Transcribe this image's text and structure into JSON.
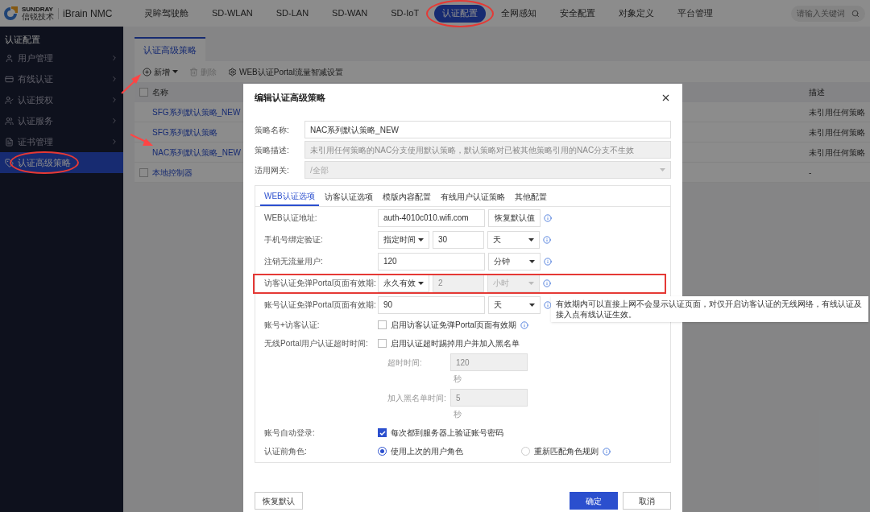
{
  "header": {
    "brand": "SUNDRAY",
    "brand_cn": "信锐技术",
    "product": "iBrain NMC",
    "nav": [
      {
        "label": "灵眸驾驶舱",
        "selected": false,
        "circled": false
      },
      {
        "label": "SD-WLAN",
        "selected": false,
        "circled": false
      },
      {
        "label": "SD-LAN",
        "selected": false,
        "circled": false
      },
      {
        "label": "SD-WAN",
        "selected": false,
        "circled": false
      },
      {
        "label": "SD-IoT",
        "selected": false,
        "circled": false
      },
      {
        "label": "认证配置",
        "selected": true,
        "circled": true
      },
      {
        "label": "全网感知",
        "selected": false,
        "circled": false
      },
      {
        "label": "安全配置",
        "selected": false,
        "circled": false
      },
      {
        "label": "对象定义",
        "selected": false,
        "circled": false
      },
      {
        "label": "平台管理",
        "selected": false,
        "circled": false
      }
    ],
    "search": {
      "placeholder": "请输入关键词"
    }
  },
  "sidebar": {
    "title": "认证配置",
    "items": [
      {
        "label": "用户管理",
        "selected": false,
        "circled": false
      },
      {
        "label": "有线认证",
        "selected": false,
        "circled": false
      },
      {
        "label": "认证授权",
        "selected": false,
        "circled": false
      },
      {
        "label": "认证服务",
        "selected": false,
        "circled": false
      },
      {
        "label": "证书管理",
        "selected": false,
        "circled": false
      },
      {
        "label": "认证高级策略",
        "selected": true,
        "circled": true
      }
    ]
  },
  "main": {
    "tab": "认证高级策略",
    "toolbar": [
      {
        "kind": "add",
        "label": "新增",
        "disabled": false,
        "annotated": true
      },
      {
        "kind": "delete",
        "label": "删除",
        "disabled": true
      },
      {
        "kind": "settings",
        "label": "WEB认证Portal流量智减设置",
        "disabled": false
      }
    ],
    "table": {
      "select_all_checked": false,
      "columns": [
        "名称",
        "描述"
      ],
      "rows": [
        {
          "name": "SFG系列默认策略_NEW",
          "description": "未引用任何策略",
          "checkbox": false,
          "annotated": false
        },
        {
          "name": "SFG系列默认策略",
          "description": "未引用任何策略",
          "checkbox": false,
          "annotated": false
        },
        {
          "name": "NAC系列默认策略_NEW",
          "description": "未引用任何策略",
          "checkbox": false,
          "annotated": true
        },
        {
          "name": "本地控制器",
          "description": "-",
          "checkbox": true,
          "checked": false,
          "annotated": false
        }
      ]
    }
  },
  "dialog": {
    "title": "编辑认证高级策略",
    "fields": [
      {
        "kind": "input",
        "label": "策略名称:",
        "value": "NAC系列默认策略_NEW",
        "disabled": false
      },
      {
        "kind": "input",
        "label": "策略描述:",
        "value": "未引用任何策略的NAC分支使用默认策略，默认策略对已被其他策略引用的NAC分支不生效",
        "disabled": true
      },
      {
        "kind": "select",
        "label": "适用网关:",
        "value": "/全部",
        "disabled": true
      }
    ],
    "tabs": [
      {
        "label": "WEB认证选项",
        "selected": true
      },
      {
        "label": "访客认证选项",
        "selected": false
      },
      {
        "label": "模版内容配置",
        "selected": false
      },
      {
        "label": "有线用户认证策略",
        "selected": false
      },
      {
        "label": "其他配置",
        "selected": false
      }
    ],
    "options": [
      {
        "kind": "text_button",
        "label": "WEB认证地址:",
        "value": "auth-4010c010.wifi.com",
        "button": "恢复默认值",
        "info": true,
        "highlighted": false
      },
      {
        "kind": "select_input_select",
        "label": "手机号绑定验证:",
        "mode": "指定时间",
        "value": "30",
        "unit": "天",
        "disabled": false,
        "info": true,
        "highlighted": false
      },
      {
        "kind": "input_select",
        "label": "注销无流量用户:",
        "value": "120",
        "unit": "分钟",
        "info": true,
        "highlighted": false
      },
      {
        "kind": "select_input_select",
        "label": "访客认证免弹Portal页面有效期:",
        "mode": "永久有效",
        "value": "2",
        "unit": "小时",
        "disabled": true,
        "info": true,
        "highlighted": true
      },
      {
        "kind": "input_select",
        "label": "账号认证免弹Portal页面有效期:",
        "value": "90",
        "unit": "天",
        "info": true,
        "highlighted": false
      },
      {
        "kind": "checkbox",
        "label": "账号+访客认证:",
        "text": "启用访客认证免弹Portal页面有效期",
        "checked": false,
        "info": true
      },
      {
        "kind": "checkbox",
        "label": "无线Portal用户认证超时时间:",
        "text": "启用认证超时踢掉用户并加入黑名单",
        "checked": false,
        "info": false,
        "subfields": [
          {
            "label": "超时时间:",
            "value": "120",
            "unit": "秒"
          },
          {
            "label": "加入黑名单时间:",
            "value": "5",
            "unit": "秒"
          }
        ]
      },
      {
        "kind": "checkbox",
        "label": "账号自动登录:",
        "text": "每次都到服务器上验证账号密码",
        "checked": true,
        "info": false
      },
      {
        "kind": "radio",
        "label": "认证前角色:",
        "choices": [
          {
            "label": "使用上次的用户角色",
            "selected": true,
            "info": false
          },
          {
            "label": "重新匹配角色规则",
            "selected": false,
            "info": true
          }
        ]
      }
    ],
    "tooltip": "有效期内可以直接上网不会显示认证页面，对仅开启访客认证的无线网络，有线认证及接入点有线认证生效。",
    "footer": {
      "reset": "恢复默认",
      "confirm": "确定",
      "cancel": "取消"
    }
  }
}
